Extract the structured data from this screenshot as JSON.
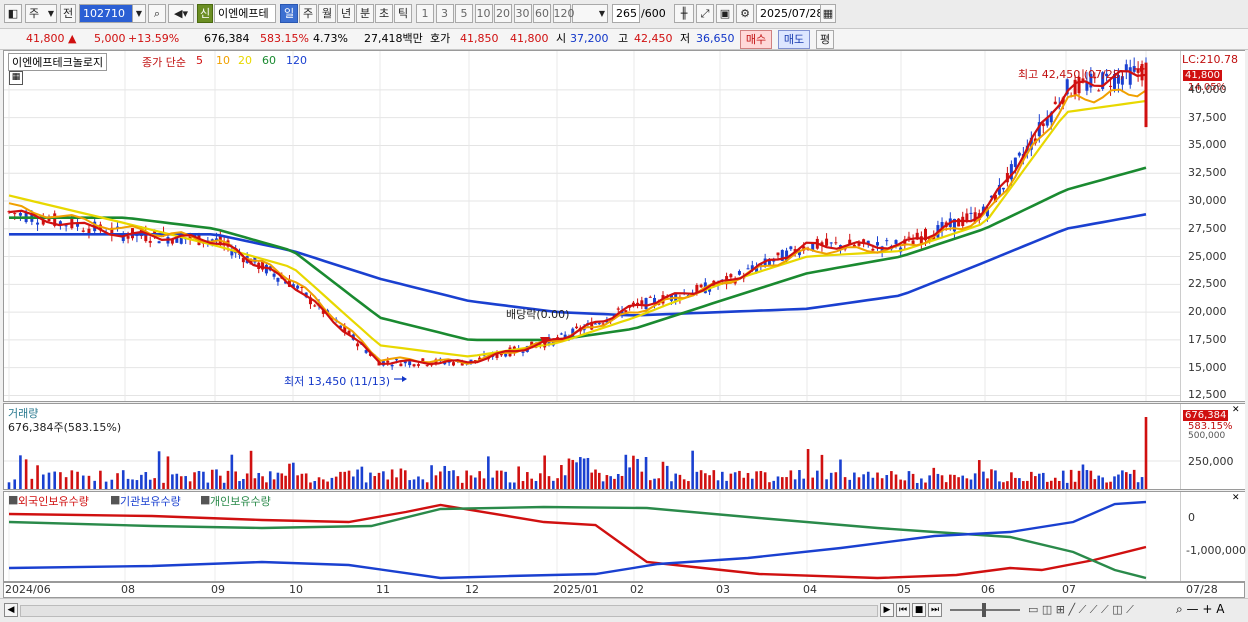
{
  "toolbar": {
    "period_label": "주",
    "prev_label": "전",
    "code_value": "102710",
    "new_badge": "신",
    "stock_name": "이엔에프테",
    "periods": [
      "일",
      "주",
      "월",
      "년",
      "분",
      "초",
      "틱"
    ],
    "intervals": [
      "1",
      "3",
      "5",
      "10",
      "20",
      "30",
      "60",
      "120"
    ],
    "count_value": "265",
    "count_total": "/600",
    "date_value": "2025/07/28"
  },
  "infobar": {
    "price": "41,800",
    "change_arrow": "▲",
    "change": "5,000",
    "change_pct": "+13.59%",
    "volume": "676,384",
    "volume_pct": "583.15%",
    "turnover": "4.73%",
    "amount": "27,418백만",
    "quote_label": "호가",
    "ask": "41,850",
    "bid": "41,800",
    "open_label": "시",
    "open": "37,200",
    "high_label": "고",
    "high": "42,450",
    "low_label": "저",
    "low": "36,650",
    "buy_label": "매수",
    "sell_label": "매도",
    "eval_label": "평"
  },
  "price_panel": {
    "name": "이엔에프테크놀로지",
    "ma_label": "종가 단순",
    "ma_periods": [
      "5",
      "10",
      "20",
      "60",
      "120"
    ],
    "ma_colors": [
      "#d01010",
      "#f0a000",
      "#e8d800",
      "#1a8a30",
      "#1a40d0"
    ],
    "lc_label": "LC:210.78",
    "last_tag": "41,800",
    "last_pct": "14.05%",
    "max_label": "최고 42,450 (07/28)",
    "min_label": "최저 13,450 (11/13)",
    "dividend_label": "배당락(0.00)",
    "y_ticks": [
      "40,000",
      "37,500",
      "35,000",
      "32,500",
      "30,000",
      "27,500",
      "25,000",
      "22,500",
      "20,000",
      "17,500",
      "15,000",
      "12,500"
    ]
  },
  "volume_panel": {
    "title": "거래량",
    "value_label": "676,384주(583.15%)",
    "tag_value": "676,384",
    "tag_pct": "583.15%",
    "y_ticks": [
      "500,000",
      "250,000"
    ]
  },
  "holding_panel": {
    "legend": [
      "외국인보유수량",
      "기관보유수량",
      "개인보유수량"
    ],
    "legend_colors": [
      "#d01010",
      "#1a40d0",
      "#2a8a4a"
    ],
    "y_ticks": [
      "0",
      "-1,000,000"
    ]
  },
  "x_axis": {
    "labels": [
      "2024/06",
      "08",
      "09",
      "10",
      "11",
      "12",
      "2025/01",
      "02",
      "03",
      "04",
      "05",
      "06",
      "07",
      "07/28"
    ]
  },
  "chart_data": {
    "type": "line",
    "title": "",
    "xlabel": "",
    "ylabel": "",
    "x": [
      "2024/06",
      "08",
      "09",
      "10",
      "11",
      "12",
      "2025/01",
      "02",
      "03",
      "04",
      "05",
      "06",
      "07",
      "07/28"
    ],
    "ylim": [
      12500,
      42450
    ],
    "series": [
      {
        "name": "5",
        "values": [
          29000,
          27000,
          26500,
          22500,
          15500,
          15500,
          17500,
          20500,
          22500,
          26000,
          26000,
          29000,
          40000,
          41800
        ]
      },
      {
        "name": "10",
        "values": [
          29500,
          27500,
          26500,
          23000,
          15800,
          15500,
          17500,
          20000,
          22500,
          25500,
          25700,
          28500,
          39000,
          40000
        ]
      },
      {
        "name": "20",
        "values": [
          30500,
          28000,
          26000,
          24000,
          17000,
          16000,
          17200,
          19500,
          22500,
          25000,
          25500,
          28000,
          38000,
          39000
        ]
      },
      {
        "name": "60",
        "values": [
          28500,
          28500,
          27500,
          25500,
          19500,
          17500,
          17500,
          18500,
          21000,
          23500,
          25000,
          27500,
          31000,
          33000
        ]
      },
      {
        "name": "120",
        "values": [
          27000,
          27000,
          27000,
          25500,
          23000,
          21000,
          20000,
          19700,
          20000,
          20300,
          21500,
          24500,
          27500,
          28800
        ]
      }
    ]
  }
}
